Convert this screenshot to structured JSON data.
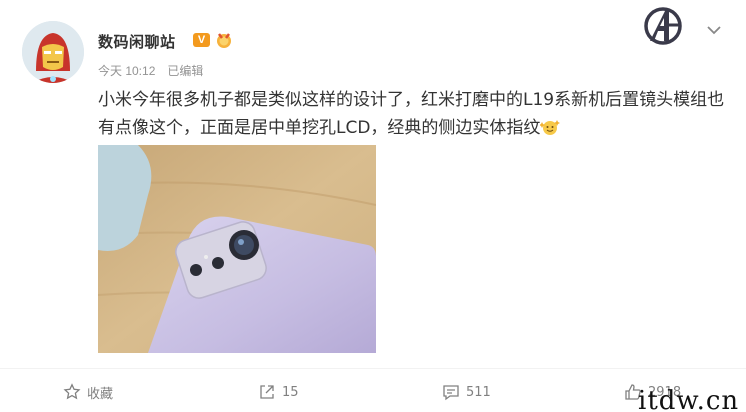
{
  "post": {
    "author": "数码闲聊站",
    "badge_v": "V",
    "time": "今天 10:12",
    "edited": "已编辑",
    "text": "小米今年很多机子都是类似这样的设计了，红米打磨中的L19系新机后置镜头模组也有点像这个，正面是居中单挖孔LCD，经典的侧边实体指纹"
  },
  "actions": {
    "favorite": "收藏",
    "forward": "15",
    "comment": "511",
    "like": "2918"
  },
  "icons": {
    "avatar": "iron-man-avatar",
    "medal": "medal-icon",
    "logo": "avengers-logo-icon",
    "menu": "chevron-down-icon",
    "emoji": "sparkle-emoji-icon"
  },
  "watermark": "itdw.cn"
}
